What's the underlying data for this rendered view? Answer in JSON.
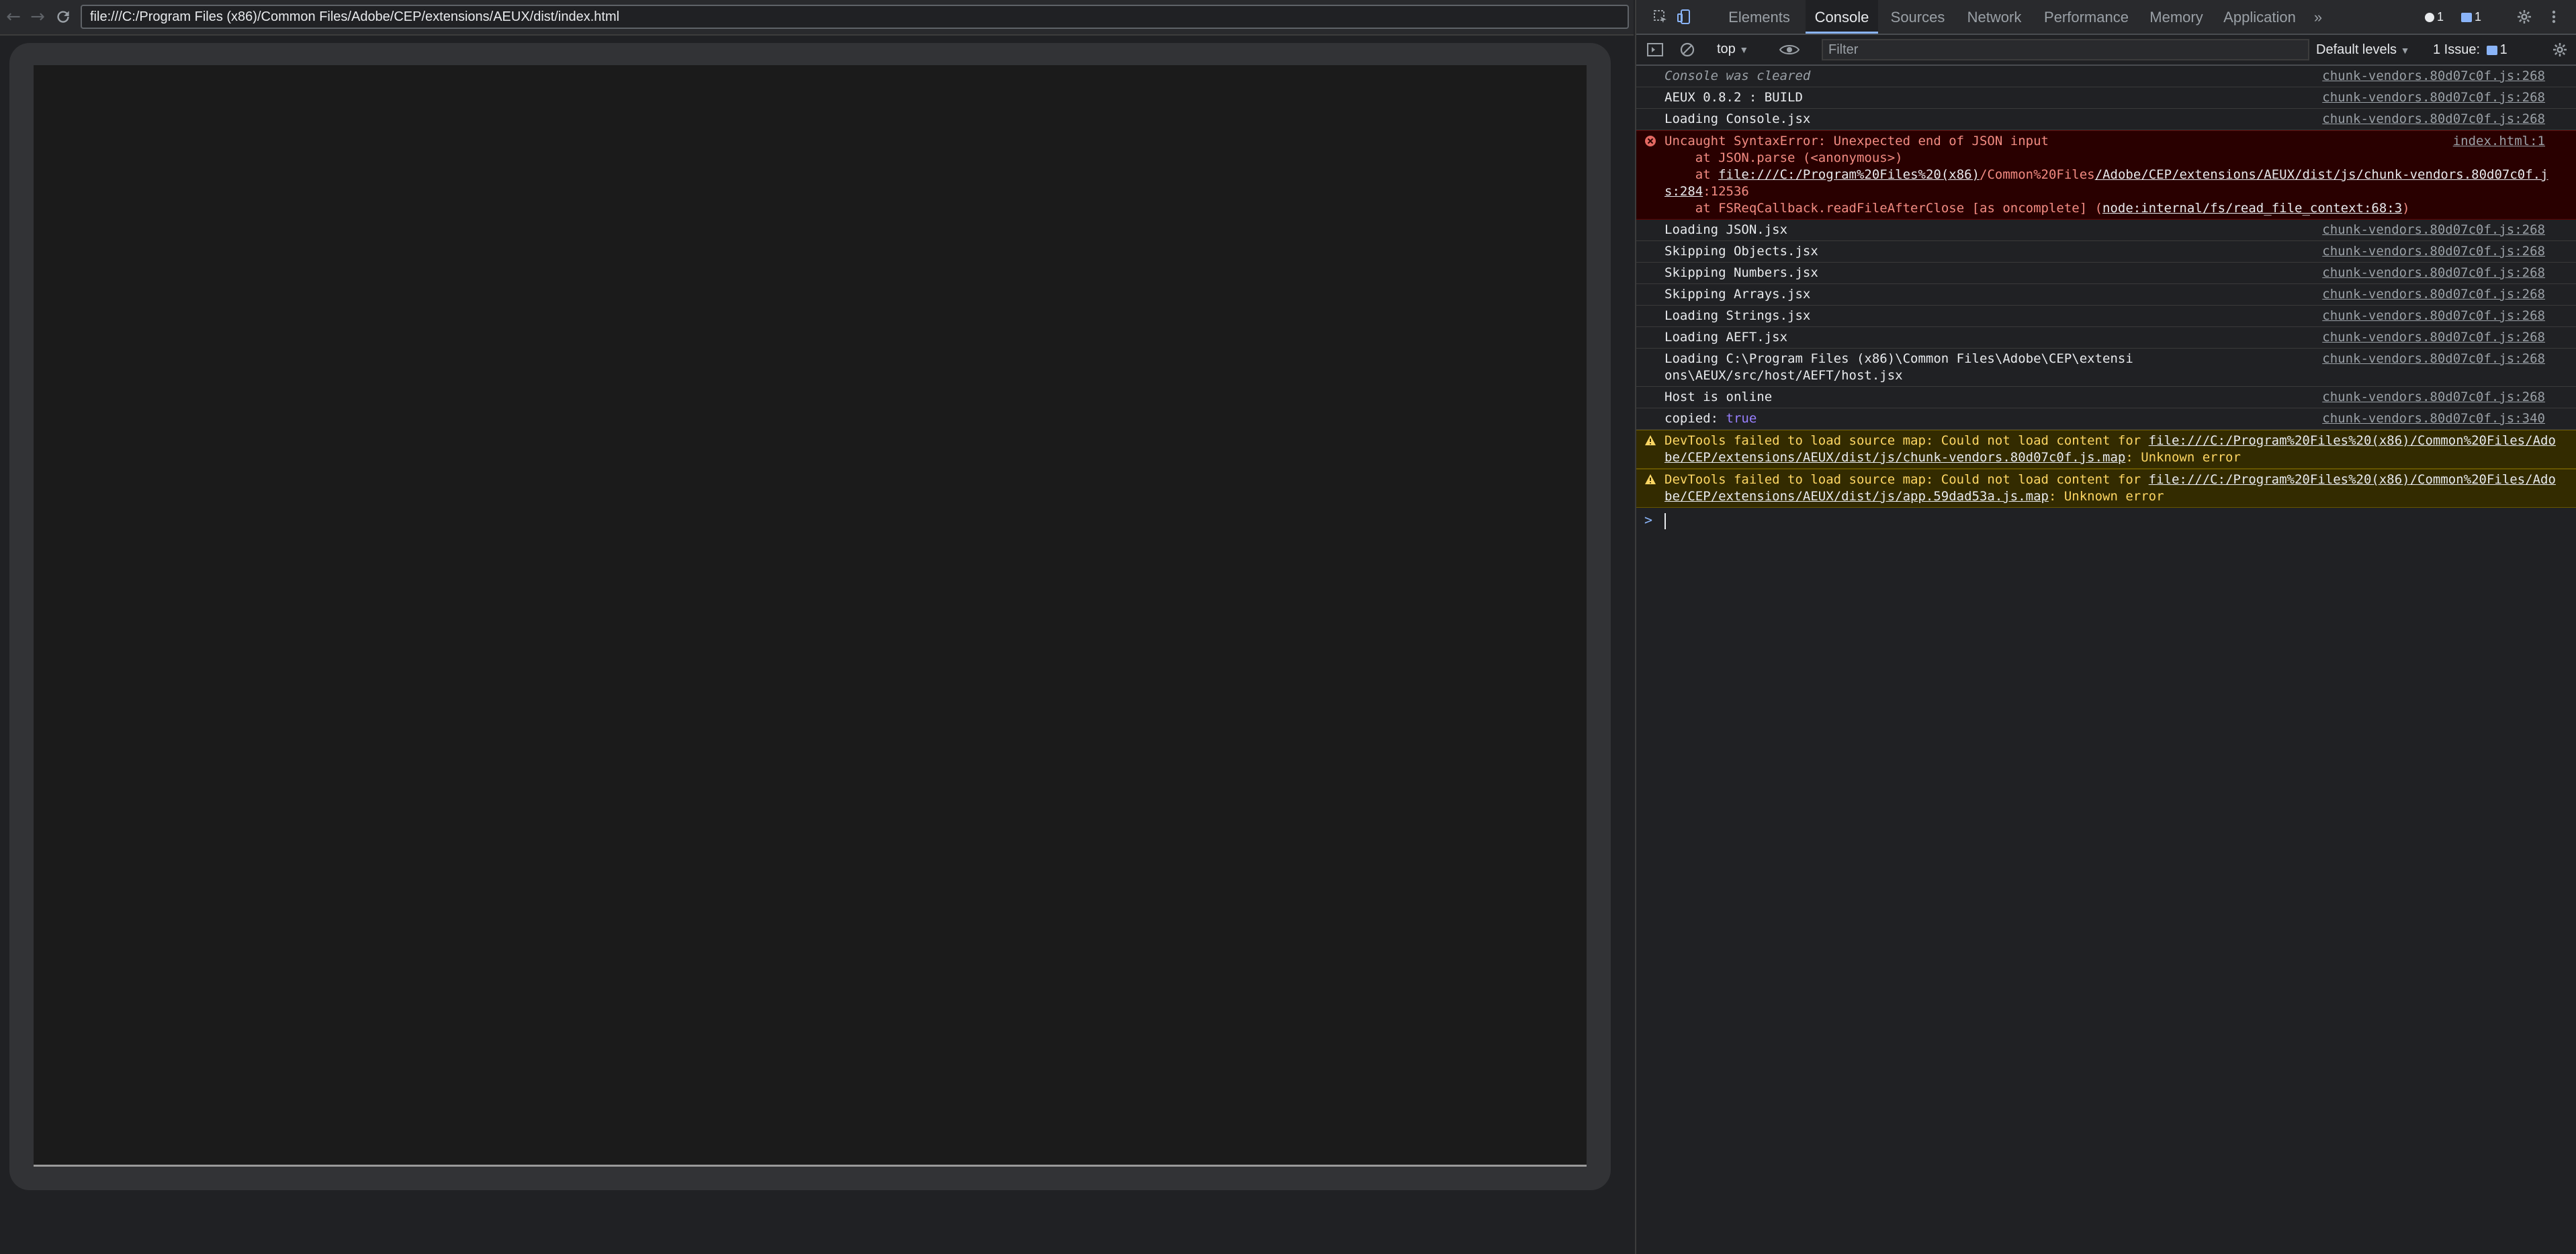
{
  "browser": {
    "url": "file:///C:/Program Files (x86)/Common Files/Adobe/CEP/extensions/AEUX/dist/index.html"
  },
  "devtools": {
    "tabs": [
      "Elements",
      "Console",
      "Sources",
      "Network",
      "Performance",
      "Memory",
      "Application"
    ],
    "active_tab": "Console",
    "more_tabs": "»",
    "error_count": "1",
    "message_count": "1",
    "toolbar": {
      "context": "top",
      "filter_placeholder": "Filter",
      "levels": "Default levels",
      "issues_label": "1 Issue:",
      "issues_count": "1"
    },
    "console": {
      "cleared": "Console was cleared",
      "src_268": "chunk-vendors.80d07c0f.js:268",
      "src_340": "chunk-vendors.80d07c0f.js:340",
      "rows": [
        {
          "text": "AEUX 0.8.2 : BUILD"
        },
        {
          "text": "Loading Console.jsx"
        }
      ],
      "error": {
        "title": "Uncaught SyntaxError: Unexpected end of JSON input",
        "line1": "at JSON.parse (<anonymous>)",
        "line2_prefix": "at ",
        "line2_link_a": "file:///C:/Program%20Files%20(x86)",
        "line2_mid": "/Common%20Files",
        "line2_link_b": "/Adobe/CEP/extensions/AEUX/dist/js/chunk-vendors.80d07c0f.js:284",
        "line2_suffix": ":12536",
        "line3_prefix": "at FSReqCallback.readFileAfterClose [as oncomplete] (",
        "line3_link": "node:internal/fs/read_file_context:68:3",
        "line3_suffix": ")",
        "src": "index.html:1"
      },
      "rows2": [
        {
          "text": "Loading JSON.jsx"
        },
        {
          "text": "Skipping Objects.jsx"
        },
        {
          "text": "Skipping Numbers.jsx"
        },
        {
          "text": "Skipping Arrays.jsx"
        },
        {
          "text": "Loading Strings.jsx"
        },
        {
          "text": "Loading AEFT.jsx"
        },
        {
          "text": "Loading C:\\Program Files (x86)\\Common Files\\Adobe\\CEP\\extensions\\AEUX/src/host/AEFT/host.jsx"
        },
        {
          "text": "Host is online"
        }
      ],
      "copied_label": "copied: ",
      "copied_value": "true",
      "warnings": [
        {
          "prefix": "DevTools failed to load source map: Could not load content for ",
          "link": "file:///C:/Program%20Files%20(x86)/Common%20Files/Adobe/CEP/extensions/AEUX/dist/js/chunk-vendors.80d07c0f.js.map",
          "suffix": ": Unknown error"
        },
        {
          "prefix": "DevTools failed to load source map: Could not load content for ",
          "link": "file:///C:/Program%20Files%20(x86)/Common%20Files/Adobe/CEP/extensions/AEUX/dist/js/app.59dad53a.js.map",
          "suffix": ": Unknown error"
        }
      ],
      "prompt": ">"
    }
  },
  "colors": {
    "error_bg": "#290000",
    "warn_bg": "#332b00",
    "accent": "#8ab4f8"
  }
}
